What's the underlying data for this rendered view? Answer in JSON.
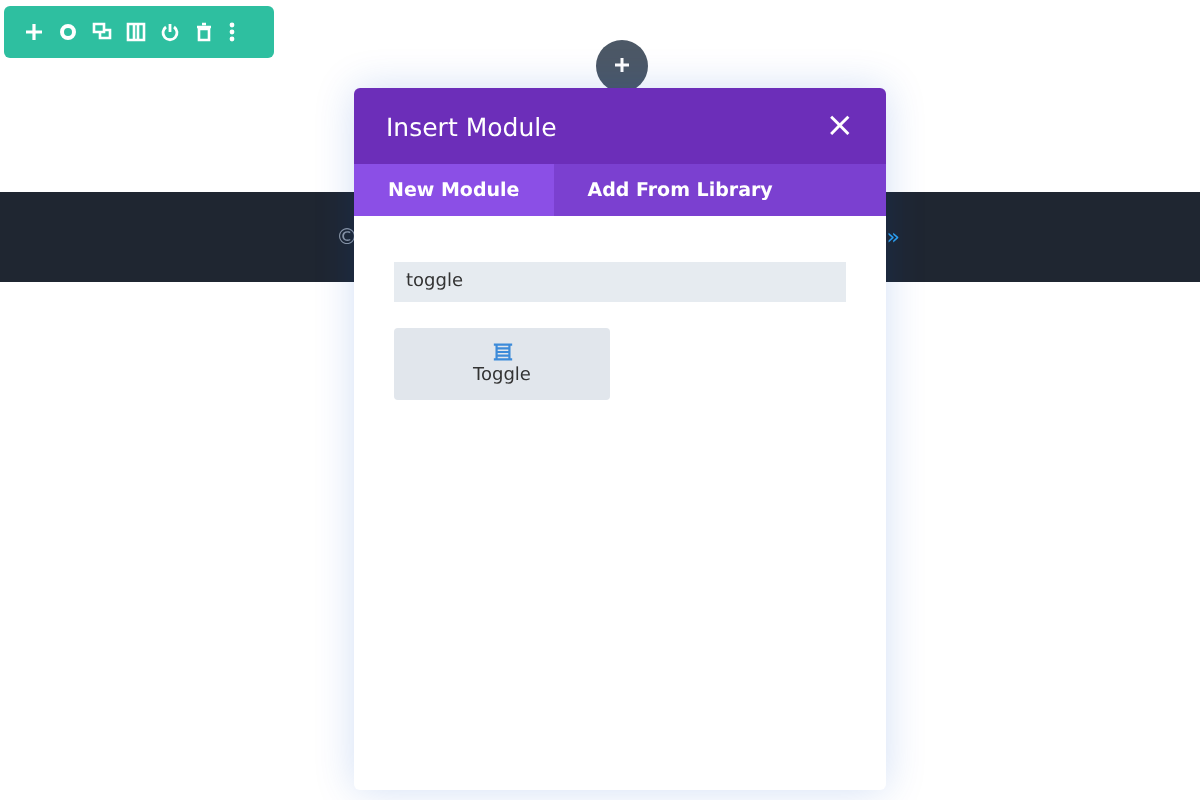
{
  "footer": {
    "left_fragment": "©",
    "right_fragment": "»"
  },
  "modal": {
    "title": "Insert Module",
    "close": "×",
    "tabs": [
      {
        "label": "New Module",
        "selected": true
      },
      {
        "label": "Add From Library",
        "selected": false
      }
    ],
    "search": {
      "value": "toggle"
    },
    "modules": [
      {
        "label": "Toggle"
      }
    ]
  }
}
